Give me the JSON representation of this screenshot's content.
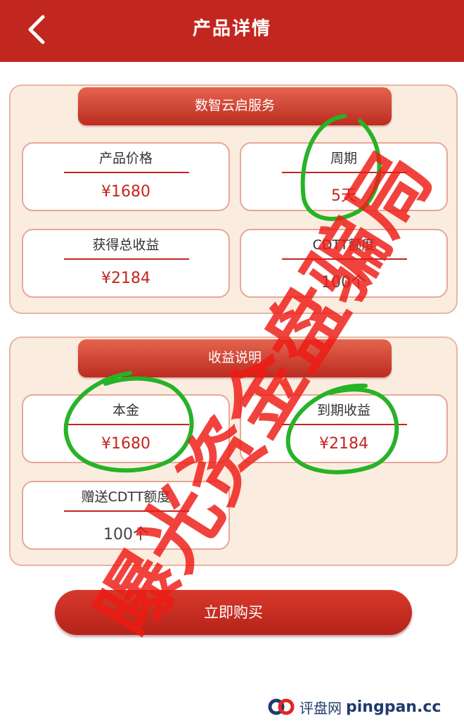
{
  "header": {
    "title": "产品详情"
  },
  "service_panel": {
    "banner": "数智云启服务",
    "cards": [
      {
        "label": "产品价格",
        "value": "¥1680"
      },
      {
        "label": "周期",
        "value": "5天"
      },
      {
        "label": "获得总收益",
        "value": "¥2184"
      },
      {
        "label": "CDTT额度",
        "value": "100个"
      }
    ]
  },
  "income_panel": {
    "banner": "收益说明",
    "cards": [
      {
        "label": "本金",
        "value": "¥1680"
      },
      {
        "label": "到期收益",
        "value": "¥2184"
      },
      {
        "label": "赠送CDTT额度",
        "value": "100个"
      }
    ]
  },
  "buy_button": {
    "label": "立即购买"
  },
  "overlay": {
    "stamp_text": "曝光资金盘骗局"
  },
  "footer": {
    "site_cn": "评盘网",
    "site_en": "pingpan.cc"
  },
  "colors": {
    "header": "#c2271f",
    "accent_red": "#c2271f",
    "panel_bg": "#fbece0",
    "annotation_green": "#26b326"
  },
  "icons": {
    "back": "chevron-left-icon",
    "logo": "pingpan-logo-icon"
  }
}
